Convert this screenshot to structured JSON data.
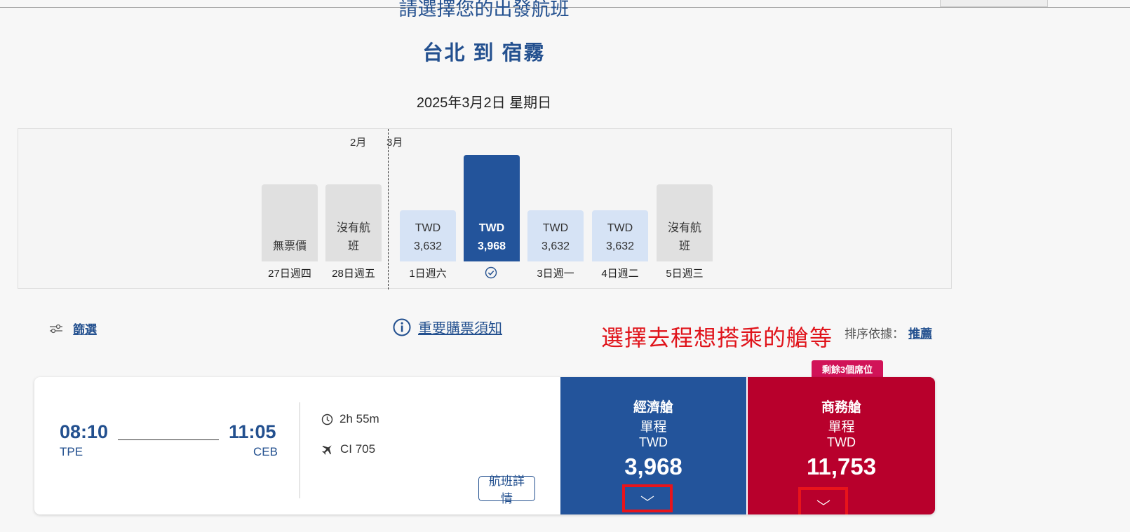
{
  "header": {
    "heading": "請選擇您的出發航班",
    "route_title": "台北 到 宿霧",
    "selected_date": "2025年3月2日 星期日"
  },
  "date_strip": {
    "months": [
      "2月",
      "3月"
    ],
    "days": [
      {
        "label": "27日週四",
        "line1": "無票價",
        "line2": "",
        "state": "unavailable"
      },
      {
        "label": "28日週五",
        "line1": "沒有航",
        "line2": "班",
        "state": "unavailable"
      },
      {
        "label": "1日週六",
        "line1": "TWD",
        "line2": "3,632",
        "state": "available"
      },
      {
        "label": "",
        "line1": "TWD",
        "line2": "3,968",
        "state": "selected"
      },
      {
        "label": "3日週一",
        "line1": "TWD",
        "line2": "3,632",
        "state": "available"
      },
      {
        "label": "4日週二",
        "line1": "TWD",
        "line2": "3,632",
        "state": "available"
      },
      {
        "label": "5日週三",
        "line1": "沒有航",
        "line2": "班",
        "state": "unavailable"
      }
    ]
  },
  "toolbar": {
    "filter_label": "篩選",
    "notice_label": "重要購票須知",
    "annotation": "選擇去程想搭乘的艙等",
    "sort_label": "排序依據：",
    "sort_value": "推薦"
  },
  "flight": {
    "dep_time": "08:10",
    "dep_code": "TPE",
    "arr_time": "11:05",
    "arr_code": "CEB",
    "duration": "2h 55m",
    "flight_no": "CI 705",
    "details_label": "航班詳情"
  },
  "fares": {
    "seats_left_badge": "剩餘3個席位",
    "economy": {
      "class": "經濟艙",
      "trip": "單程",
      "currency": "TWD",
      "price": "3,968"
    },
    "business": {
      "class": "商務艙",
      "trip": "單程",
      "currency": "TWD",
      "price": "11,753"
    }
  },
  "colors": {
    "brand_blue": "#23549b",
    "business_red": "#b8002c",
    "annotation_red": "#e0141b"
  }
}
